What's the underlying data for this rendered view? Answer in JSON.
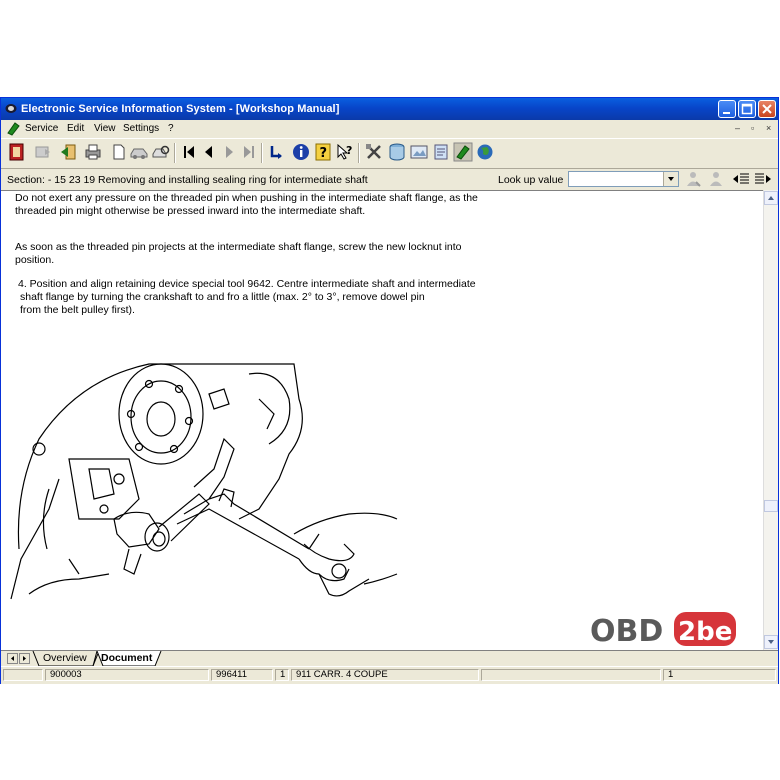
{
  "window": {
    "title": "Electronic Service Information System - [Workshop Manual]"
  },
  "menu": {
    "items": [
      "Service",
      "Edit",
      "View",
      "Settings",
      "?"
    ]
  },
  "section": {
    "label": "Section: - 15 23 19 Removing and installing sealing ring for intermediate shaft",
    "lookup_label": "Look up value"
  },
  "document": {
    "paragraphs": [
      "Do not exert any pressure on the threaded pin when pushing in the intermediate shaft flange, as the",
      "threaded pin might otherwise be pressed inward into the intermediate shaft.",
      "As soon as the threaded pin projects at the intermediate shaft flange, screw the new locknut into",
      "position.",
      "4. Position and align retaining device special tool 9642. Centre intermediate shaft and intermediate",
      "shaft flange by turning the crankshaft to and fro a little (max. 2° to 3°, remove dowel pin",
      "from the belt pulley first)."
    ]
  },
  "tabs": {
    "overview": "Overview",
    "document": "Document"
  },
  "status": {
    "c1": "900003",
    "c2": "996411",
    "c3": "1",
    "c4": "911 CARR. 4 COUPE",
    "c5": "1"
  },
  "watermark": {
    "text_a": "OBD",
    "text_b": "2be"
  },
  "colors": {
    "titlebar": "#0845c9",
    "chrome": "#ece9d8",
    "watermark_gray": "#5a5a5a",
    "watermark_red": "#d6353a"
  }
}
